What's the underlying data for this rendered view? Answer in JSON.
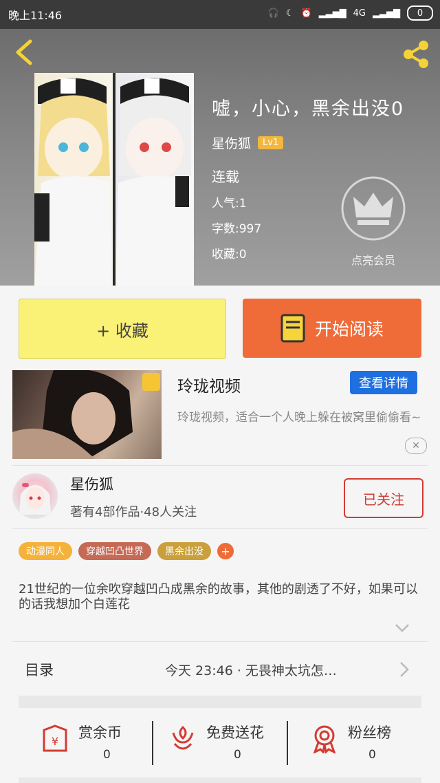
{
  "status_bar": {
    "time": "晚上11:46",
    "signal": "4G",
    "battery": "0"
  },
  "hero": {
    "title": "嘘，小心，黑余出没0",
    "author": "星伤狐",
    "level": "Lv1",
    "status": "连载",
    "popularity": "人气:1",
    "word_count": "字数:997",
    "favorites": "收藏:0",
    "vip_label": "点亮会员"
  },
  "actions": {
    "favorite_label": "+ 收藏",
    "read_label": "开始阅读"
  },
  "ad": {
    "title": "玲珑视频",
    "button_label": "查看详情",
    "description": "玲珑视频，适合一个人晚上躲在被窝里偷偷看~",
    "close_label": "✕"
  },
  "author_card": {
    "name": "星伤狐",
    "subtitle": "著有4部作品·48人关注",
    "follow_label": "已关注"
  },
  "tags": [
    {
      "label": "动漫同人",
      "color": "#f5b23a"
    },
    {
      "label": "穿越凹凸世界",
      "color": "#c56a55"
    },
    {
      "label": "黑余出没",
      "color": "#c9a03c"
    }
  ],
  "tag_add": "+",
  "description": "21世纪的一位余吹穿越凹凸成黑余的故事，其他的剧透了不好，如果可以的话我想加个白莲花",
  "toc": {
    "label": "目录",
    "latest": "今天 23:46 · 无畏神太坑怎…"
  },
  "bottom_actions": [
    {
      "label": "赏余币",
      "count": "0",
      "icon": "coin-envelope-icon"
    },
    {
      "label": "免费送花",
      "count": "0",
      "icon": "flower-icon"
    },
    {
      "label": "粉丝榜",
      "count": "0",
      "icon": "badge-ribbon-icon"
    }
  ],
  "colors": {
    "accent_orange": "#ef6b38",
    "fav_yellow": "#faf177",
    "link_blue": "#1e6fe0",
    "follow_red": "#d33b33"
  }
}
